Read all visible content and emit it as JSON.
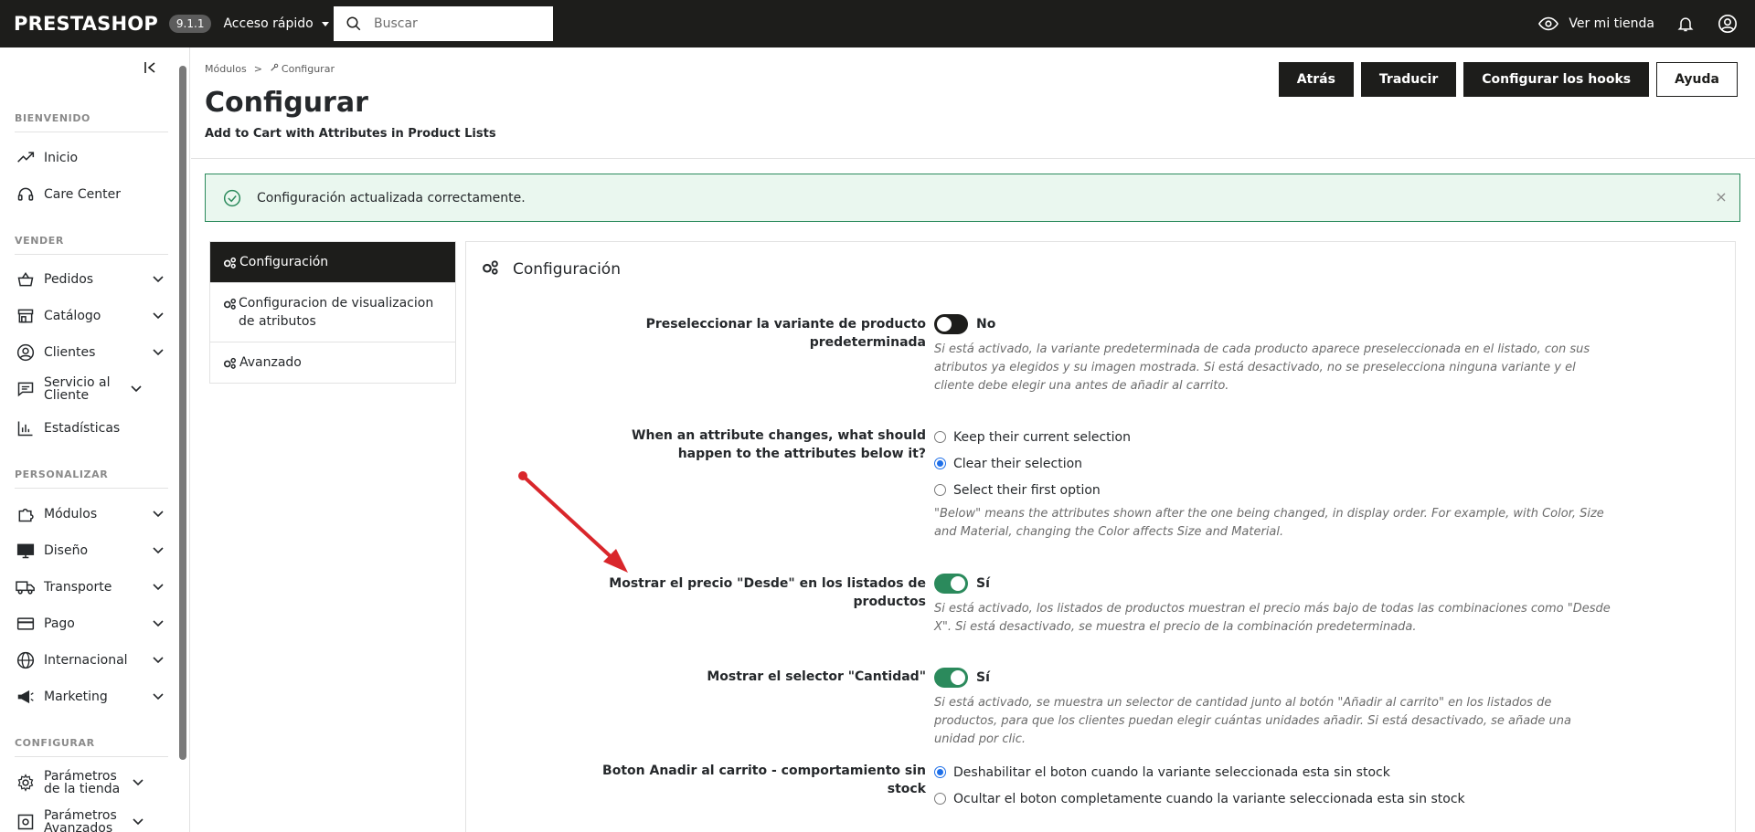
{
  "topbar": {
    "logo": "PRESTASHOP",
    "version": "9.1.1",
    "quick_access": "Acceso rápido",
    "search_placeholder": "Buscar",
    "view_shop": "Ver mi tienda"
  },
  "sidebar": {
    "sections": {
      "welcome": "BIENVENIDO",
      "sell": "VENDER",
      "customize": "PERSONALIZAR",
      "configure": "CONFIGURAR"
    },
    "items": [
      {
        "label": "Inicio",
        "icon": "trending-up-icon"
      },
      {
        "label": "Care Center",
        "icon": "headset-icon"
      },
      {
        "label": "Pedidos",
        "icon": "basket-icon"
      },
      {
        "label": "Catálogo",
        "icon": "store-icon"
      },
      {
        "label": "Clientes",
        "icon": "user-circle-icon"
      },
      {
        "label": "Servicio al Cliente",
        "icon": "chat-icon"
      },
      {
        "label": "Estadísticas",
        "icon": "bar-chart-icon"
      },
      {
        "label": "Módulos",
        "icon": "puzzle-icon"
      },
      {
        "label": "Diseño",
        "icon": "monitor-icon"
      },
      {
        "label": "Transporte",
        "icon": "truck-icon"
      },
      {
        "label": "Pago",
        "icon": "credit-card-icon"
      },
      {
        "label": "Internacional",
        "icon": "globe-icon"
      },
      {
        "label": "Marketing",
        "icon": "megaphone-icon"
      },
      {
        "label": "Parámetros de la tienda",
        "icon": "gear-icon"
      },
      {
        "label": "Parámetros Avanzados",
        "icon": "gear-box-icon"
      }
    ]
  },
  "header": {
    "breadcrumb_parent": "Módulos",
    "breadcrumb_sep": ">",
    "breadcrumb_current": "Configurar",
    "title": "Configurar",
    "subtitle": "Add to Cart with Attributes in Product Lists",
    "buttons": {
      "back": "Atrás",
      "translate": "Traducir",
      "hooks": "Configurar los hooks",
      "help": "Ayuda"
    }
  },
  "alert": {
    "text": "Configuración actualizada correctamente.",
    "close": "×"
  },
  "tabs": [
    {
      "label": "Configuración"
    },
    {
      "label": "Configuracion de visualizacion de atributos"
    },
    {
      "label": "Avanzado"
    }
  ],
  "panel": {
    "title": "Configuración",
    "fields": {
      "preselect": {
        "label": "Preseleccionar la variante de producto predeterminada",
        "state": "No",
        "enabled": false,
        "help": "Si está activado, la variante predeterminada de cada producto aparece preseleccionada en el listado, con sus atributos ya elegidos y su imagen mostrada. Si está desactivado, no se preselecciona ninguna variante y el cliente debe elegir una antes de añadir al carrito."
      },
      "attr_change": {
        "label": "When an attribute changes, what should happen to the attributes below it?",
        "options": [
          "Keep their current selection",
          "Clear their selection",
          "Select their first option"
        ],
        "selected": "Clear their selection",
        "help": "\"Below\" means the attributes shown after the one being changed, in display order. For example, with Color, Size and Material, changing the Color affects Size and Material."
      },
      "from_price": {
        "label": "Mostrar el precio \"Desde\" en los listados de productos",
        "state": "Sí",
        "enabled": true,
        "help": "Si está activado, los listados de productos muestran el precio más bajo de todas las combinaciones como \"Desde X\". Si está desactivado, se muestra el precio de la combinación predeterminada."
      },
      "quantity": {
        "label": "Mostrar el selector \"Cantidad\"",
        "state": "Sí",
        "enabled": true,
        "help": "Si está activado, se muestra un selector de cantidad junto al botón \"Añadir al carrito\" en los listados de productos, para que los clientes puedan elegir cuántas unidades añadir. Si está desactivado, se añade una unidad por clic."
      },
      "out_of_stock": {
        "label": "Boton Anadir al carrito - comportamiento sin stock",
        "options": [
          "Deshabilitar el boton cuando la variante seleccionada esta sin stock",
          "Ocultar el boton completamente cuando la variante seleccionada esta sin stock"
        ],
        "selected": "Deshabilitar el boton cuando la variante seleccionada esta sin stock"
      }
    }
  },
  "colors": {
    "dark": "#1d1d1b",
    "success_green": "#2b8a5c",
    "alert_bg": "#eaf7ef",
    "radio_blue": "#1e6fe8",
    "arrow_red": "#d9262b"
  }
}
